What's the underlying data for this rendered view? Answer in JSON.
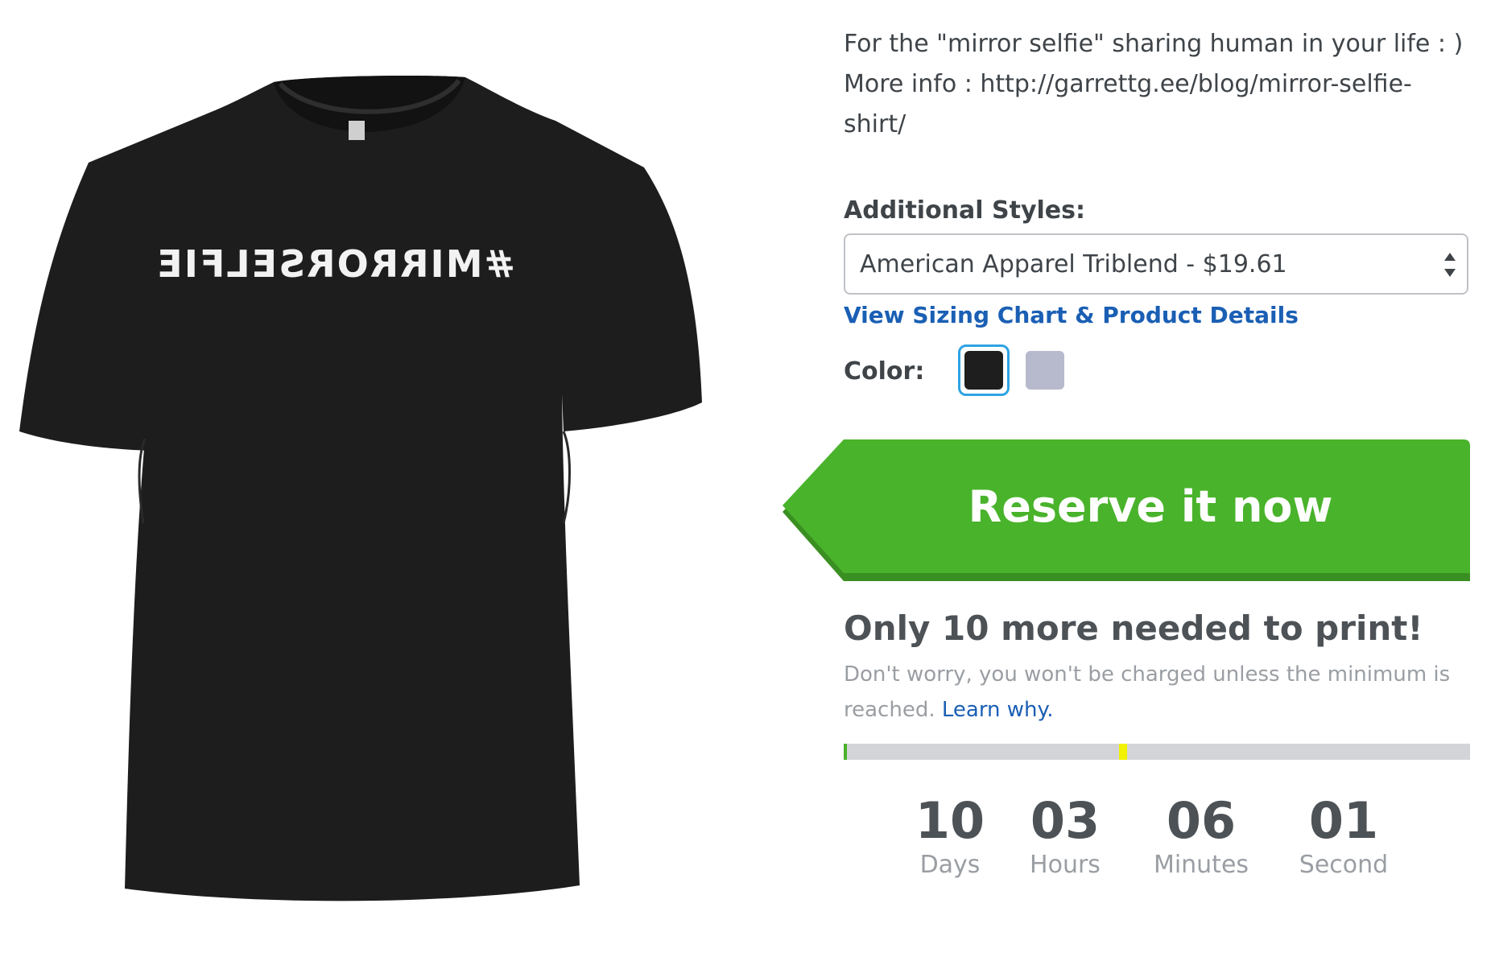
{
  "product": {
    "print_text": "#MIRRORSELFIE",
    "shirt_color": "#1d1d1d",
    "print_color": "#f2f2f2"
  },
  "description": {
    "line1": "For the \"mirror selfie\" sharing human in your life : )",
    "line2": "More info : http://garrettg.ee/blog/mirror-selfie-",
    "line3": "shirt/"
  },
  "styles": {
    "label": "Additional Styles:",
    "selected": "American Apparel Triblend - $19.61",
    "sizing_link": "View Sizing Chart & Product Details"
  },
  "color": {
    "label": "Color:",
    "options": [
      {
        "name": "black",
        "hex": "#1e1e1e",
        "selected": true
      },
      {
        "name": "heather",
        "hex": "#b7b9cc",
        "selected": false
      }
    ]
  },
  "reserve": {
    "label": "Reserve it now",
    "color": "#49b32b",
    "shadow": "#3a8f22"
  },
  "campaign": {
    "needed_text": "Only 10 more needed to print!",
    "note_text": "Don't worry, you won't be charged unless the minimum is reached.",
    "learn_link": "Learn why.",
    "progress_fraction": 0.005,
    "goal_fraction": 0.44
  },
  "countdown": [
    {
      "value": "10",
      "label": "Days"
    },
    {
      "value": "03",
      "label": "Hours"
    },
    {
      "value": "06",
      "label": "Minutes"
    },
    {
      "value": "01",
      "label": "Second"
    }
  ]
}
